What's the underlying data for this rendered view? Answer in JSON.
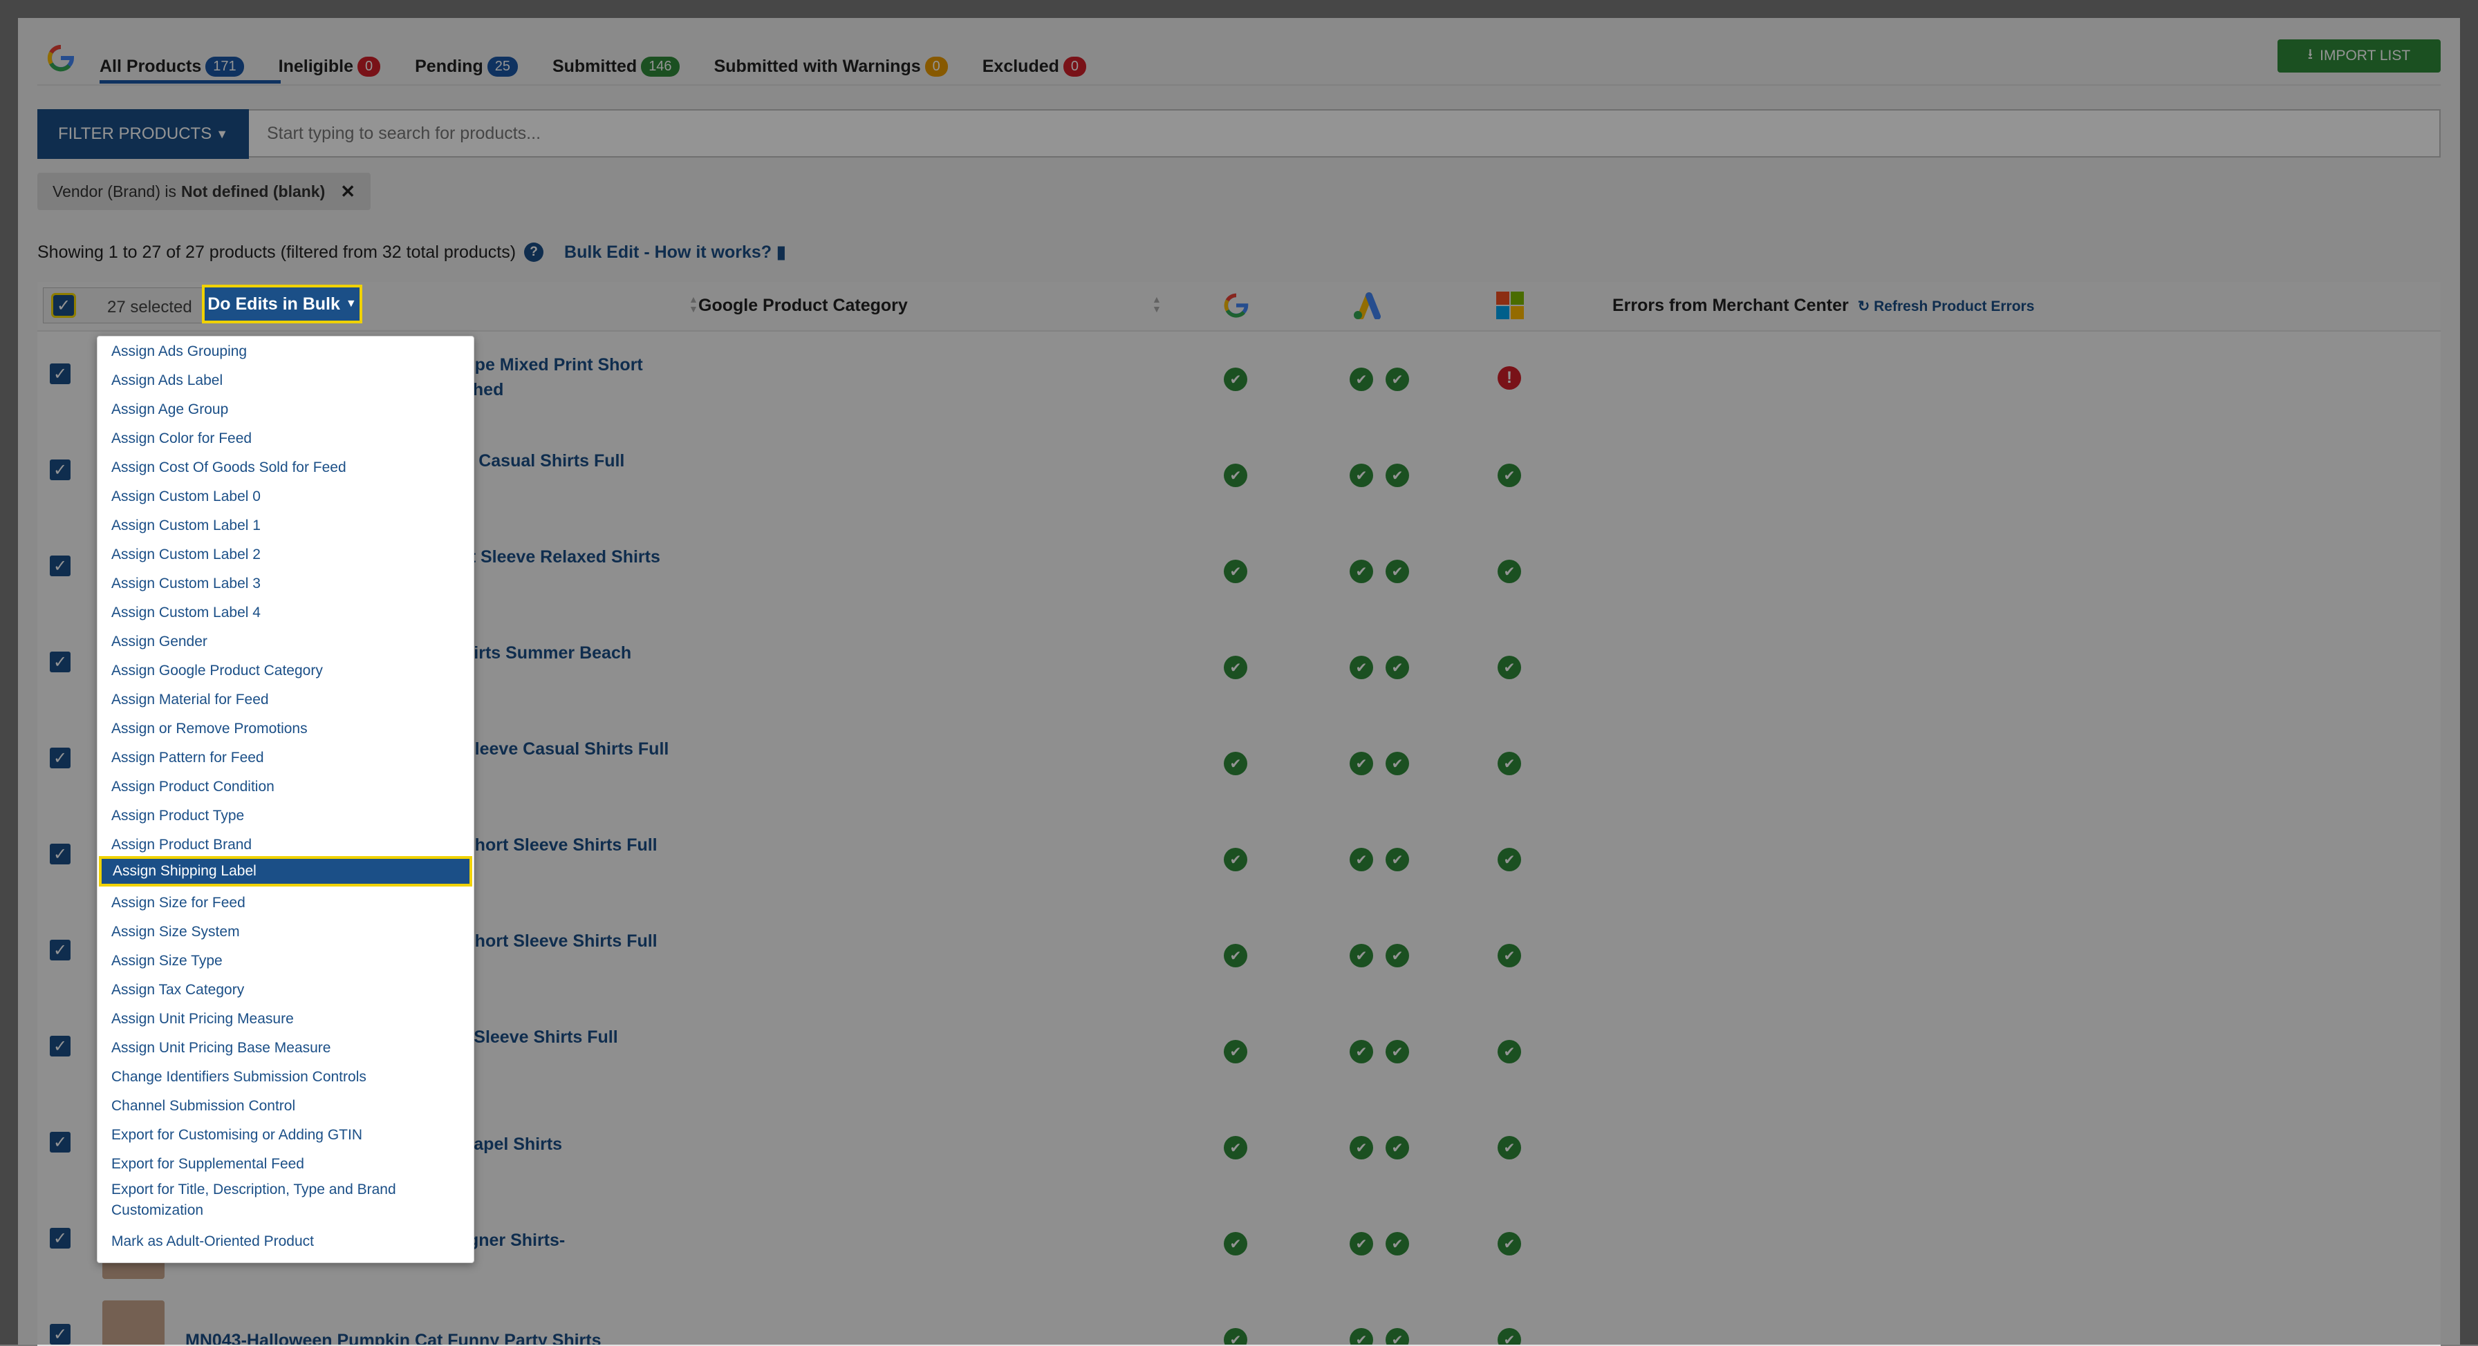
{
  "tabs": [
    {
      "label": "All Products",
      "count": "171",
      "color": "#1a56a5"
    },
    {
      "label": "Ineligible",
      "count": "0",
      "color": "#d0202a"
    },
    {
      "label": "Pending",
      "count": "25",
      "color": "#1a56a5"
    },
    {
      "label": "Submitted",
      "count": "146",
      "color": "#2f8a3a"
    },
    {
      "label": "Submitted with Warnings",
      "count": "0",
      "color": "#e89a00"
    },
    {
      "label": "Excluded",
      "count": "0",
      "color": "#d0202a"
    }
  ],
  "import_button": "IMPORT LIST",
  "filter": {
    "button_label": "FILTER PRODUCTS",
    "search_placeholder": "Start typing to search for products...",
    "chip_prefix": "Vendor (Brand) is",
    "chip_value": "Not defined (blank)"
  },
  "showing_text": "Showing 1 to 27 of 27 products (filtered from 32 total products)",
  "bulk_edit_link": "Bulk Edit - How it works?",
  "table": {
    "selected_text": "27 selected",
    "bulk_button": "Do Edits in Bulk",
    "col_category": "Google Product Category",
    "col_errors": "Errors from Merchant Center",
    "refresh_errors": "Refresh Product Errors"
  },
  "rows": [
    {
      "title": "ripe Mixed Print Short",
      "title2": "ched",
      "microsoft": "error"
    },
    {
      "title": "n Casual Shirts Full",
      "title2": "",
      "microsoft": "ok"
    },
    {
      "title": "rt Sleeve Relaxed Shirts",
      "title2": "",
      "microsoft": "ok"
    },
    {
      "title": "hirts Summer Beach",
      "title2": "",
      "microsoft": "ok"
    },
    {
      "title": "Sleeve Casual Shirts Full",
      "title2": "",
      "microsoft": "ok"
    },
    {
      "title": "Short Sleeve Shirts Full",
      "title2": "",
      "microsoft": "ok"
    },
    {
      "title": "Short Sleeve Shirts Full",
      "title2": "",
      "microsoft": "ok"
    },
    {
      "title": "t Sleeve Shirts Full",
      "title2": "",
      "microsoft": "ok"
    },
    {
      "title": "Lapel Shirts",
      "title2": "",
      "microsoft": "ok"
    },
    {
      "title": "igner Shirts-",
      "title2": "",
      "microsoft": "ok"
    },
    {
      "title": "MN043-Halloween Pumpkin Cat Funny Party Shirts",
      "title2": "",
      "microsoft": "ok"
    }
  ],
  "menu": {
    "items": [
      "Assign Ads Grouping",
      "Assign Ads Label",
      "Assign Age Group",
      "Assign Color for Feed",
      "Assign Cost Of Goods Sold for Feed",
      "Assign Custom Label 0",
      "Assign Custom Label 1",
      "Assign Custom Label 2",
      "Assign Custom Label 3",
      "Assign Custom Label 4",
      "Assign Gender",
      "Assign Google Product Category",
      "Assign Material for Feed",
      "Assign or Remove Promotions",
      "Assign Pattern for Feed",
      "Assign Product Condition",
      "Assign Product Type",
      "Assign Product Brand",
      "Assign Shipping Label",
      "Assign Size for Feed",
      "Assign Size System",
      "Assign Size Type",
      "Assign Tax Category",
      "Assign Unit Pricing Measure",
      "Assign Unit Pricing Base Measure",
      "Change Identifiers Submission Controls",
      "Channel Submission Control",
      "Export for Customising or Adding GTIN",
      "Export for Supplemental Feed",
      "Export for Title, Description, Type and Brand Customization",
      "Mark as Adult-Oriented Product"
    ],
    "selected": "Assign Shipping Label"
  }
}
